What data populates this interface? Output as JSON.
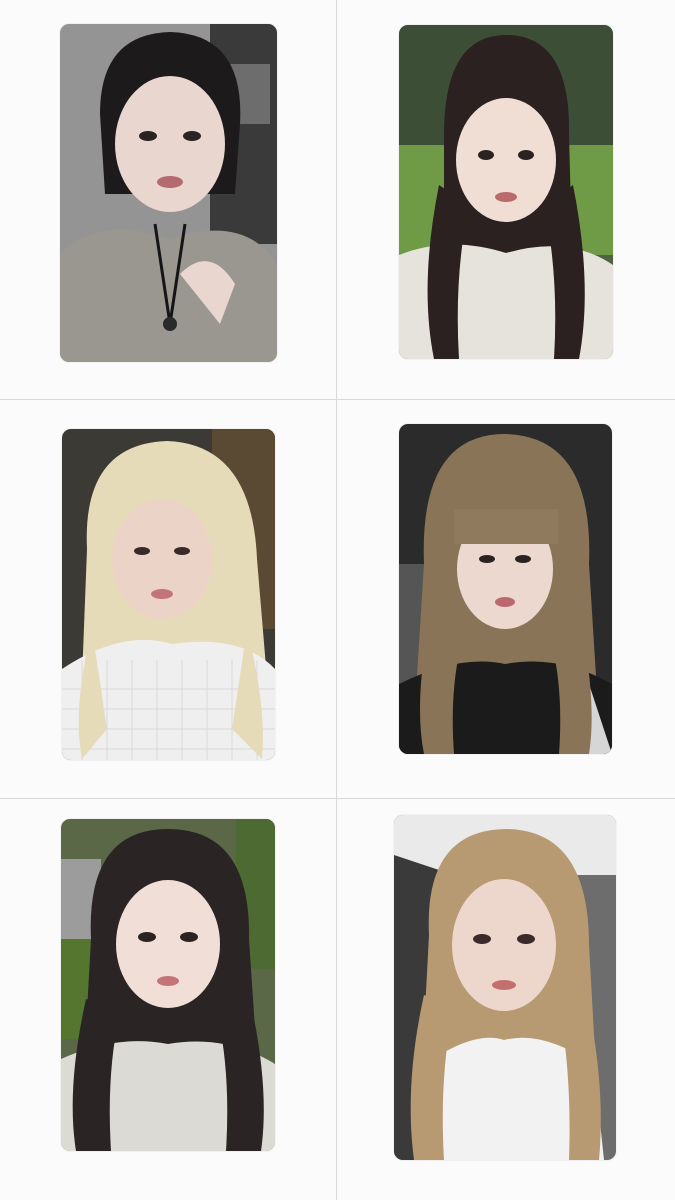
{
  "photocards": [
    {
      "member": "",
      "bg": "#8f8f8f",
      "hair": "#1c1a1a",
      "skin": "#e8d6cf",
      "top": "#9a9690"
    },
    {
      "member": "",
      "bg": "#5f7a4a",
      "hair": "#2a2120",
      "skin": "#f0ddd4",
      "top": "#e6e3dc"
    },
    {
      "member": "",
      "bg": "#3c3a34",
      "hair": "#e6dbb8",
      "skin": "#ecd3c7",
      "top": "#efefef"
    },
    {
      "member": "",
      "bg": "#2b2b2b",
      "hair": "#8a7458",
      "skin": "#ecd8cf",
      "top": "#1b1b1b"
    },
    {
      "member": "",
      "bg": "#5b6848",
      "hair": "#2a2524",
      "skin": "#f1dfd7",
      "top": "#dcdad4"
    },
    {
      "member": "",
      "bg": "#6d6d6d",
      "hair": "#b89a72",
      "skin": "#edd6cb",
      "top": "#f2f2f2"
    }
  ]
}
